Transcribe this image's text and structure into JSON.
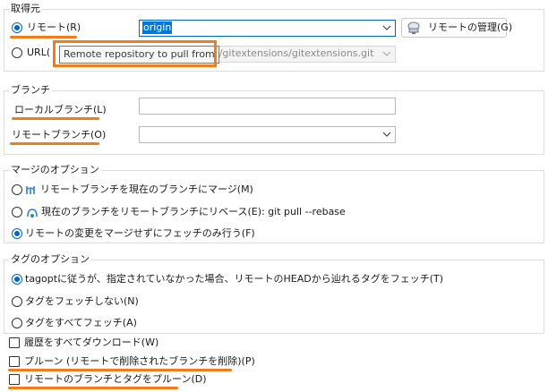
{
  "colors": {
    "highlight": "#f07d1a",
    "accent": "#0067c0"
  },
  "source": {
    "title": "取得元",
    "remote_label": "リモート(R)",
    "remote_value": "origin",
    "manage_remotes_label": "リモートの管理(G)",
    "url_label": "URL(",
    "url_value": "m/gitextensions/gitextensions.git",
    "tooltip": "Remote repository to pull from"
  },
  "branch": {
    "title": "ブランチ",
    "local_label": "ローカルブランチ(L)",
    "local_value": "",
    "remote_label": "リモートブランチ(O)",
    "remote_value": ""
  },
  "merge": {
    "title": "マージのオプション",
    "options": [
      "リモートブランチを現在のブランチにマージ(M)",
      "現在のブランチをリモートブランチにリベース(E): git pull --rebase",
      "リモートの変更をマージせずにフェッチのみ行う(F)"
    ],
    "selected_index": 2
  },
  "tags": {
    "title": "タグのオプション",
    "options": [
      "tagoptに従うが、指定されていなかった場合、リモートのHEADから辿れるタグをフェッチ(T)",
      "タグをフェッチしない(N)",
      "タグをすべてフェッチ(A)"
    ],
    "selected_index": 0
  },
  "checkboxes": [
    "履歴をすべてダウンロード(W)",
    "プルーン (リモートで削除されたブランチを削除)(P)",
    "リモートのブランチとタグをプルーン(D)"
  ]
}
